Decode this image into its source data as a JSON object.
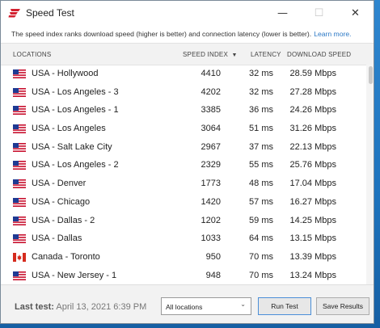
{
  "window": {
    "title": "Speed Test",
    "controls": {
      "minimize": "—",
      "maximize": "☐",
      "close": "✕"
    }
  },
  "info": {
    "text": "The speed index ranks download speed (higher is better) and connection latency (lower is better).",
    "link": "Learn more."
  },
  "columns": {
    "locations": "LOCATIONS",
    "speed_index": "SPEED INDEX",
    "sort_arrow": "▼",
    "latency": "LATENCY",
    "download_speed": "DOWNLOAD SPEED"
  },
  "rows": [
    {
      "flag": "us-flag-icon",
      "location": "USA - Hollywood",
      "speed_index": "4410",
      "latency": "32 ms",
      "download": "28.59 Mbps"
    },
    {
      "flag": "us-flag-icon",
      "location": "USA - Los Angeles - 3",
      "speed_index": "4202",
      "latency": "32 ms",
      "download": "27.28 Mbps"
    },
    {
      "flag": "us-flag-icon",
      "location": "USA - Los Angeles - 1",
      "speed_index": "3385",
      "latency": "36 ms",
      "download": "24.26 Mbps"
    },
    {
      "flag": "us-flag-icon",
      "location": "USA - Los Angeles",
      "speed_index": "3064",
      "latency": "51 ms",
      "download": "31.26 Mbps"
    },
    {
      "flag": "us-flag-icon",
      "location": "USA - Salt Lake City",
      "speed_index": "2967",
      "latency": "37 ms",
      "download": "22.13 Mbps"
    },
    {
      "flag": "us-flag-icon",
      "location": "USA - Los Angeles - 2",
      "speed_index": "2329",
      "latency": "55 ms",
      "download": "25.76 Mbps"
    },
    {
      "flag": "us-flag-icon",
      "location": "USA - Denver",
      "speed_index": "1773",
      "latency": "48 ms",
      "download": "17.04 Mbps"
    },
    {
      "flag": "us-flag-icon",
      "location": "USA - Chicago",
      "speed_index": "1420",
      "latency": "57 ms",
      "download": "16.27 Mbps"
    },
    {
      "flag": "us-flag-icon",
      "location": "USA - Dallas - 2",
      "speed_index": "1202",
      "latency": "59 ms",
      "download": "14.25 Mbps"
    },
    {
      "flag": "us-flag-icon",
      "location": "USA - Dallas",
      "speed_index": "1033",
      "latency": "64 ms",
      "download": "13.15 Mbps"
    },
    {
      "flag": "canada-flag-icon",
      "location": "Canada - Toronto",
      "speed_index": "950",
      "latency": "70 ms",
      "download": "13.39 Mbps"
    },
    {
      "flag": "us-flag-icon",
      "location": "USA - New Jersey - 1",
      "speed_index": "948",
      "latency": "70 ms",
      "download": "13.24 Mbps"
    }
  ],
  "footer": {
    "last_test_label": "Last test:",
    "last_test_value": "April 13, 2021 6:39 PM",
    "filter_selected": "All locations",
    "run_button": "Run Test",
    "save_button": "Save Results"
  },
  "colors": {
    "accent_red": "#d3202f",
    "link_blue": "#2b78c5",
    "desktop_blue": "#1d73bd"
  }
}
